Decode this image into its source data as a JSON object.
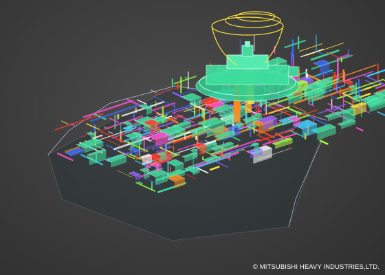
{
  "image": {
    "description_free": true
  },
  "colors": {
    "background": "#3a3a3a",
    "mint_green": "#3fe0a0",
    "cyan": "#38d0ff",
    "blue": "#3b6cff",
    "purple": "#8a5cff",
    "yellow": "#ffe23a",
    "orange": "#ff8a1e",
    "red": "#ff3a2a",
    "magenta": "#ff4fd0",
    "white": "#ffffff",
    "lime": "#9cff3a"
  },
  "watermark": {
    "text": "© MITSUBISHI HEAVY INDUSTRIES,LTD."
  }
}
